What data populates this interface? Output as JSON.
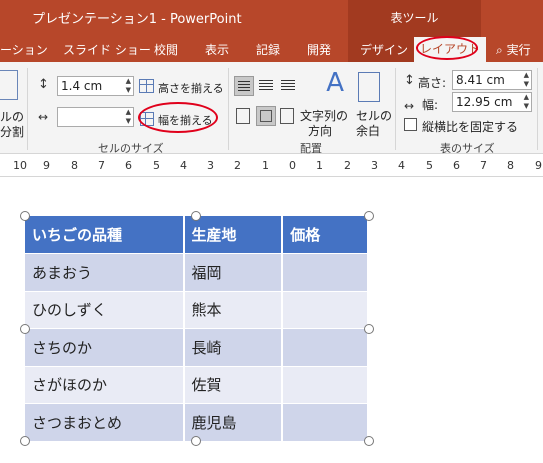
{
  "window": {
    "title": "プレゼンテーション1  -  PowerPoint",
    "context_header": "表ツール"
  },
  "tabs": [
    {
      "label": "ーション"
    },
    {
      "label": "スライド ショー"
    },
    {
      "label": "校閲"
    },
    {
      "label": "表示"
    },
    {
      "label": "記録"
    },
    {
      "label": "開発"
    },
    {
      "label": "デザイン"
    },
    {
      "label": "レイアウト"
    }
  ],
  "search": {
    "label": "実行"
  },
  "ribbon": {
    "cell_partial": {
      "line1": "ルの",
      "line2": "分割"
    },
    "cell_size": {
      "height_value": "1.4 cm",
      "width_value": "",
      "distribute_rows": "高さを揃える",
      "distribute_cols": "幅を揃える",
      "label": "セルのサイズ"
    },
    "alignment": {
      "text_direction_line1": "文字列の",
      "text_direction_line2": "方向",
      "cell_margins_line1": "セルの",
      "cell_margins_line2": "余白",
      "label": "配置"
    },
    "table_size": {
      "height_label": "高さ:",
      "height_value": "8.41 cm",
      "width_label": "幅:",
      "width_value": "12.95 cm",
      "lock_aspect": "縦横比を固定する",
      "label": "表のサイズ"
    }
  },
  "ruler": {
    "numbers": [
      "10",
      "9",
      "8",
      "7",
      "6",
      "5",
      "4",
      "3",
      "2",
      "1",
      "0",
      "1",
      "2",
      "3",
      "4",
      "5",
      "6",
      "7",
      "8",
      "9"
    ]
  },
  "table": {
    "headers": [
      "いちごの品種",
      "生産地",
      "価格"
    ],
    "rows": [
      [
        "あまおう",
        "福岡",
        ""
      ],
      [
        "ひのしずく",
        "熊本",
        ""
      ],
      [
        "さちのか",
        "長崎",
        ""
      ],
      [
        "さがほのか",
        "佐賀",
        ""
      ],
      [
        "さつまおとめ",
        "鹿児島",
        ""
      ]
    ]
  },
  "colors": {
    "accent": "#b7472a",
    "table_header": "#4472c4",
    "row_dark": "#cfd5ea",
    "row_light": "#e9ebf5",
    "highlight": "#e0001b"
  }
}
